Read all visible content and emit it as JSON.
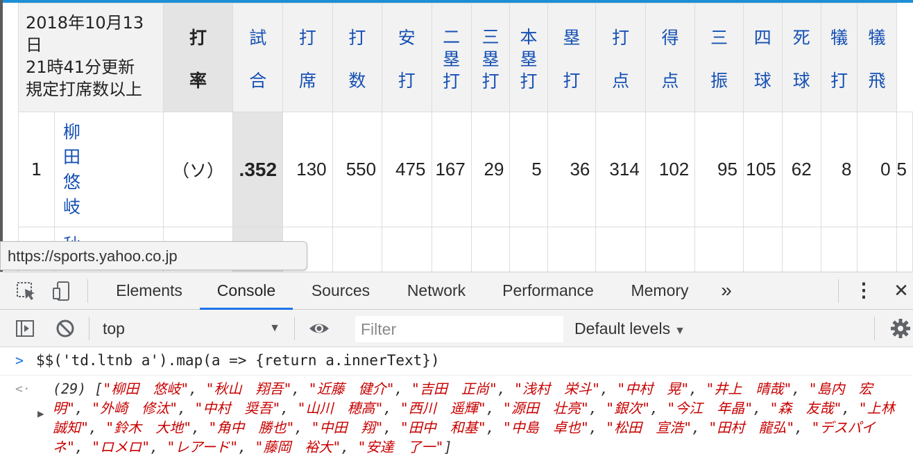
{
  "page": {
    "updated_date": "2018年10月13日",
    "updated_time": "21時41分更新",
    "qualified_note": "規定打席数以上",
    "columns": [
      "打率",
      "試合",
      "打席",
      "打数",
      "安打",
      "二塁打",
      "三塁打",
      "本塁打",
      "塁打",
      "打点",
      "得点",
      "三振",
      "四球",
      "死球",
      "犠打",
      "犠飛"
    ],
    "rows": [
      {
        "rank": "1",
        "player": "柳田悠岐",
        "team": "（ソ）",
        "stats": [
          ".352",
          "130",
          "550",
          "475",
          "167",
          "29",
          "5",
          "36",
          "314",
          "102",
          "95",
          "105",
          "62",
          "8",
          "0",
          "5"
        ]
      },
      {
        "rank": "",
        "player": "秋",
        "team": "",
        "stats": []
      }
    ]
  },
  "url_tooltip": "https://sports.yahoo.co.jp",
  "devtools": {
    "tabs": [
      "Elements",
      "Console",
      "Sources",
      "Network",
      "Performance",
      "Memory"
    ],
    "active_tab": "Console",
    "more_tabs_glyph": "»",
    "menu_glyph": "⋮",
    "close_glyph": "✕",
    "icons": [
      "inspect-element-icon",
      "device-toolbar-icon",
      "sidebar-toggle-icon",
      "clear-console-icon",
      "eye-icon",
      "gear-icon"
    ],
    "context": "top",
    "filter_placeholder": "Filter",
    "levels": "Default levels",
    "console_input": "$$('td.ltnb a').map(a => {return a.innerText})",
    "result_count": "(29)",
    "result_items": [
      "柳田　悠岐",
      "秋山　翔吾",
      "近藤　健介",
      "吉田　正尚",
      "浅村　栄斗",
      "中村　晃",
      "井上　晴哉",
      "島内　宏明",
      "外崎　修汰",
      "中村　奨吾",
      "山川　穂高",
      "西川　遥輝",
      "源田　壮亮",
      "銀次",
      "今江　年晶",
      "森　友哉",
      "上林　誠知",
      "鈴木　大地",
      "角中　勝也",
      "中田　翔",
      "田中　和基",
      "中島　卓也",
      "松田　宣浩",
      "田村　龍弘",
      "デスパイネ",
      "ロメロ",
      "レアード",
      "藤岡　裕大",
      "安達　了一"
    ],
    "colors": {
      "accent": "#1a73e8",
      "error_red": "#c80000",
      "link_blue": "#1550b4"
    }
  }
}
